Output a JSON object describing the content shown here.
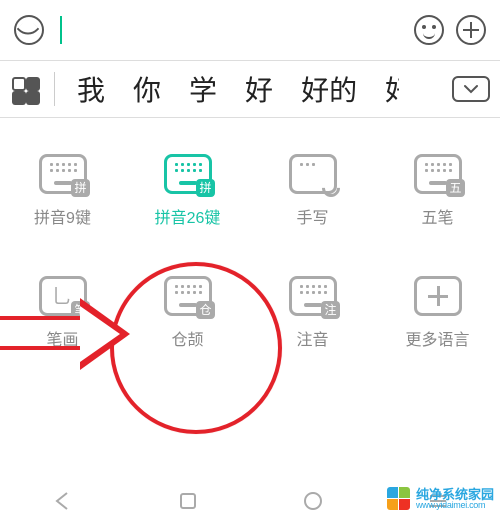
{
  "topbar": {
    "mic_name": "voice-input-icon",
    "smiley_name": "emoji-icon",
    "plus_name": "add-icon"
  },
  "candidates": {
    "items": [
      "我",
      "你",
      "学",
      "好",
      "好的",
      "好"
    ],
    "expand_name": "expand-candidates"
  },
  "layouts": [
    {
      "id": "pinyin9",
      "label": "拼音9键",
      "badge": "拼",
      "variant": "keys",
      "active": false
    },
    {
      "id": "pinyin26",
      "label": "拼音26键",
      "badge": "拼",
      "variant": "keys",
      "active": true
    },
    {
      "id": "handwrite",
      "label": "手写",
      "badge": "",
      "variant": "hand",
      "active": false
    },
    {
      "id": "wubi",
      "label": "五笔",
      "badge": "五",
      "variant": "keys",
      "active": false
    },
    {
      "id": "bihua",
      "label": "笔画",
      "badge": "笔",
      "variant": "stroke",
      "active": false
    },
    {
      "id": "cangjie",
      "label": "仓颉",
      "badge": "仓",
      "variant": "keys",
      "active": false
    },
    {
      "id": "zhuyin",
      "label": "注音",
      "badge": "注",
      "variant": "keys",
      "active": false
    },
    {
      "id": "more",
      "label": "更多语言",
      "badge": "",
      "variant": "plus",
      "active": false
    }
  ],
  "annotation": {
    "target": "pinyin26",
    "color": "#e3222a"
  },
  "watermark": {
    "title": "纯净系统家园",
    "url": "www.yidaimei.com"
  }
}
